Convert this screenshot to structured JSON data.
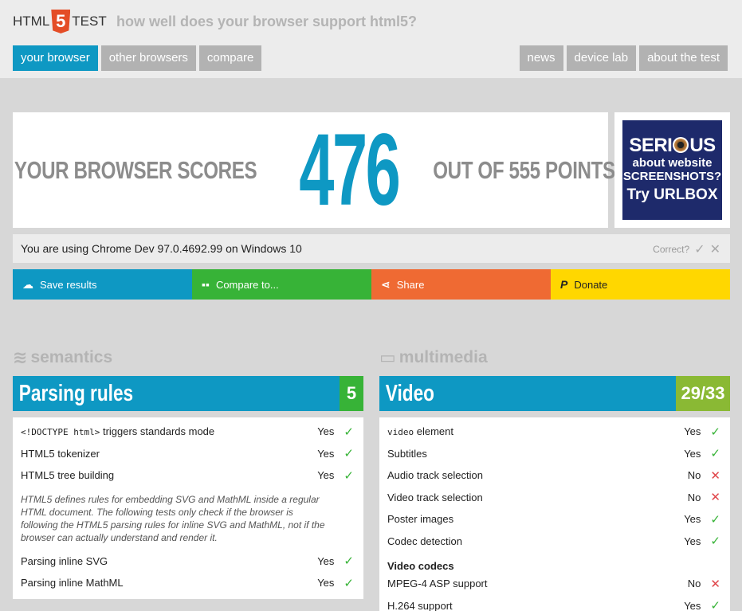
{
  "header": {
    "logo_left": "HTML",
    "logo_num": "5",
    "logo_right": "TEST",
    "tagline": "how well does your browser support html5?"
  },
  "nav_left": [
    "your browser",
    "other browsers",
    "compare"
  ],
  "nav_right": [
    "news",
    "device lab",
    "about the test"
  ],
  "score": {
    "prefix": "YOUR BROWSER SCORES",
    "value": "476",
    "suffix": "OUT OF 555 POINTS"
  },
  "ad": {
    "l1a": "SERI",
    "l1b": "US",
    "l2a": "about website",
    "l2b": "SCREENSHOTS?",
    "l3": "Try URLBOX"
  },
  "using": {
    "text": "You are using Chrome Dev 97.0.4692.99 on Windows 10",
    "correct_label": "Correct?"
  },
  "actions": {
    "save": "Save results",
    "compare": "Compare to...",
    "share": "Share",
    "donate": "Donate"
  },
  "colors": {
    "blue": "#0e98c3",
    "green": "#37b337",
    "orange": "#ef6a33",
    "yellow": "#ffd700"
  },
  "left": {
    "category": "semantics",
    "title": "Parsing rules",
    "score": "5",
    "rows": [
      {
        "label": "<!DOCTYPE html>",
        "label2": " triggers standards mode",
        "result": "Yes"
      },
      {
        "label": "HTML5 tokenizer",
        "result": "Yes"
      },
      {
        "label": "HTML5 tree building",
        "result": "Yes"
      }
    ],
    "note": "HTML5 defines rules for embedding SVG and MathML inside a regular HTML document. The following tests only check if the browser is following the HTML5 parsing rules for inline SVG and MathML, not if the browser can actually understand and render it.",
    "rows2": [
      {
        "label": "Parsing inline SVG",
        "result": "Yes"
      },
      {
        "label": "Parsing inline MathML",
        "result": "Yes"
      }
    ]
  },
  "right": {
    "category": "multimedia",
    "title": "Video",
    "score": "29/33",
    "rows": [
      {
        "code": "video",
        "label": " element",
        "result": "Yes"
      },
      {
        "label": "Subtitles",
        "result": "Yes"
      },
      {
        "label": "Audio track selection",
        "result": "No"
      },
      {
        "label": "Video track selection",
        "result": "No"
      },
      {
        "label": "Poster images",
        "result": "Yes"
      },
      {
        "label": "Codec detection",
        "result": "Yes"
      }
    ],
    "subhead": "Video codecs",
    "rows2": [
      {
        "label": "MPEG-4 ASP support",
        "result": "No"
      },
      {
        "label": "H.264 support",
        "result": "Yes"
      }
    ]
  }
}
